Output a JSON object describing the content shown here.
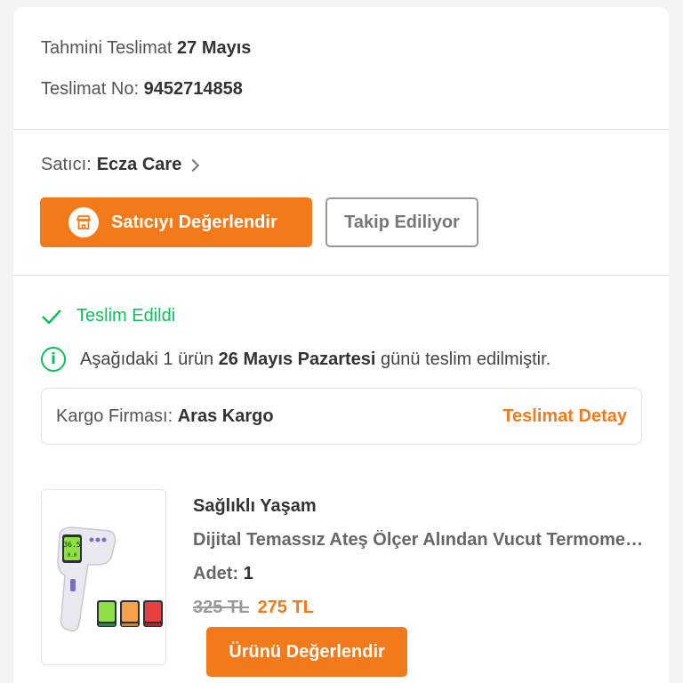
{
  "delivery_header": {
    "estimated_label": "Tahmini Teslimat",
    "estimated_value": "27 Mayıs",
    "tracking_label": "Teslimat No:",
    "tracking_value": "9452714858"
  },
  "seller": {
    "label": "Satıcı:",
    "name": "Ecza Care",
    "rate_button": "Satıcıyı Değerlendir",
    "follow_button": "Takip Ediliyor"
  },
  "delivery_status": {
    "status": "Teslim Edildi",
    "info_prefix": "Aşağıdaki 1 ürün",
    "info_date": "26 Mayıs Pazartesi",
    "info_suffix": "günü teslim edilmiştir.",
    "cargo_label": "Kargo Firması:",
    "cargo_name": "Aras Kargo",
    "cargo_detail_link": "Teslimat Detay",
    "status_color": "#0bc15c"
  },
  "product": {
    "brand": "Sağlıklı Yaşam",
    "name": "Dijital Temassız Ateş Ölçer Alından Vucut Termometresi",
    "qty_label": "Adet:",
    "qty_value": "1",
    "old_price": "325 TL",
    "new_price": "275 TL",
    "rate_button": "Ürünü Değerlendir",
    "screen_reading_1": "36.5",
    "screen_reading_2": "0.0"
  },
  "accent_color": "#f27a1a"
}
